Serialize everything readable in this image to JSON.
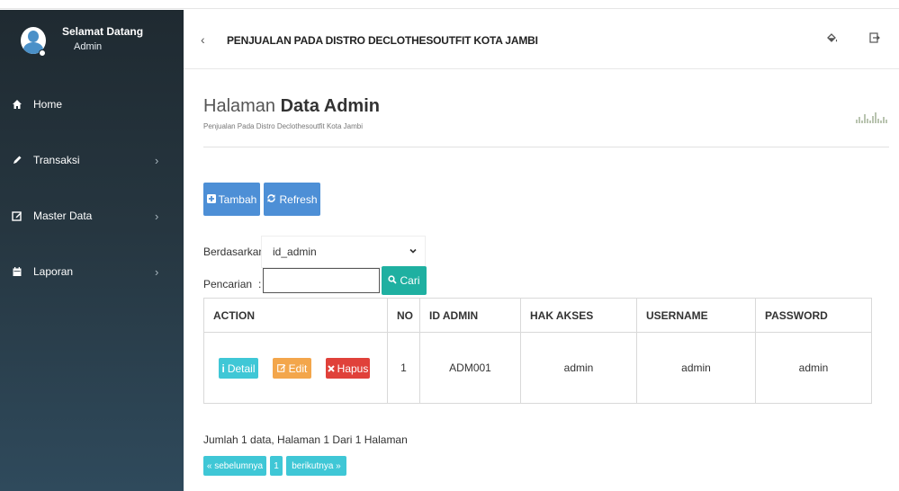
{
  "sidebar": {
    "greeting": "Selamat Datang",
    "role": "Admin",
    "items": [
      {
        "label": "Home",
        "icon": "home-icon",
        "has_submenu": false
      },
      {
        "label": "Transaksi",
        "icon": "pencil-icon",
        "has_submenu": true
      },
      {
        "label": "Master Data",
        "icon": "edit-icon",
        "has_submenu": true
      },
      {
        "label": "Laporan",
        "icon": "calendar-icon",
        "has_submenu": true
      }
    ],
    "chevron": "›"
  },
  "topbar": {
    "back": "‹",
    "title": "PENJUALAN PADA DISTRO DECLOTHESOUTFIT KOTA JAMBI",
    "icons": [
      "paint-bucket-icon",
      "logout-icon"
    ]
  },
  "page": {
    "title_light": "Halaman ",
    "title_bold": "Data Admin",
    "subtitle": "Penjualan Pada Distro Declothesoutfit Kota Jambi"
  },
  "toolbar": {
    "add_label": "Tambah",
    "refresh_label": "Refresh"
  },
  "filter": {
    "label": "Berdasarkan:",
    "selected": "id_admin",
    "search_label": "Pencarian",
    "search_colon": ":",
    "search_value": "",
    "search_button": "Cari"
  },
  "table": {
    "headers": [
      "ACTION",
      "NO",
      "ID ADMIN",
      "HAK AKSES",
      "USERNAME",
      "PASSWORD"
    ],
    "rows": [
      {
        "actions": {
          "detail": "Detail",
          "edit": "Edit",
          "delete": "Hapus"
        },
        "no": "1",
        "id_admin": "ADM001",
        "hak_akses": "admin",
        "username": "admin",
        "password": "admin"
      }
    ]
  },
  "summary": "Jumlah 1 data, Halaman 1 Dari 1 Halaman",
  "pagination": {
    "prev": "« sebelumnya",
    "page": "1",
    "next": "berikutnya »"
  },
  "colors": {
    "sidebar_top": "#1f2a31",
    "sidebar_bottom": "#2f4a5c",
    "primary": "#4d8fd6",
    "info": "#3fc7d6",
    "warning": "#f3a64b",
    "danger": "#e0413a",
    "success": "#1fb0a1"
  }
}
